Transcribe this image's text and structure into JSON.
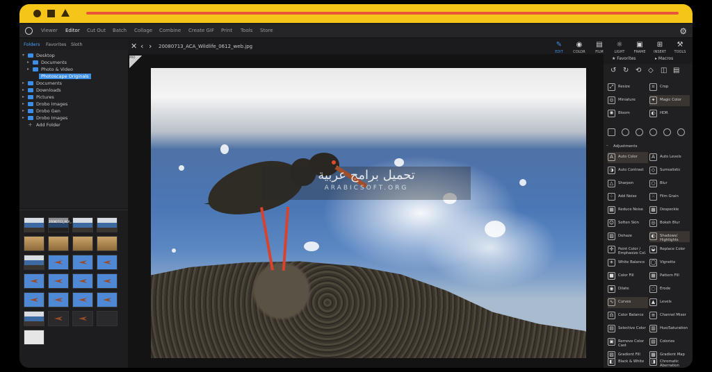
{
  "menu": [
    "Viewer",
    "Editor",
    "Cut Out",
    "Batch",
    "Collage",
    "Combine",
    "Create GIF",
    "Print",
    "Tools",
    "Store"
  ],
  "menu_active": "Editor",
  "side_tabs": [
    "Folders",
    "Favorites",
    "Sloth"
  ],
  "tree": [
    {
      "label": "Desktop",
      "depth": 0,
      "expanded": true
    },
    {
      "label": "Documents",
      "depth": 1
    },
    {
      "label": "Photo & Video",
      "depth": 1
    },
    {
      "label": "Photoscape Originals",
      "depth": 1,
      "selected": true
    },
    {
      "label": "Documents",
      "depth": 0
    },
    {
      "label": "Downloads",
      "depth": 0
    },
    {
      "label": "Pictures",
      "depth": 0
    },
    {
      "label": "Drobo Images",
      "depth": 0
    },
    {
      "label": "Drobo Gen",
      "depth": 0
    },
    {
      "label": "Drobo Images",
      "depth": 0
    },
    {
      "label": "Add Folder",
      "depth": 0,
      "add": true
    }
  ],
  "thumb_caption": "20080713_ACA_..._.jpg",
  "file_name": "20080713_ACA_Wildlife_0612_web.jpg",
  "badge": "PRO",
  "top_tools": [
    "EDIT",
    "COLOR",
    "FILM",
    "LIGHT",
    "FRAME",
    "INSERT",
    "TOOLS"
  ],
  "right_tabs": [
    "Favorites",
    "Macros"
  ],
  "tools_top": [
    [
      "Resize",
      "Crop"
    ],
    [
      "Miniature",
      "Magic Color"
    ],
    [
      "Bloom",
      "HDR"
    ]
  ],
  "adjustments_label": "Adjustments",
  "adjustments": [
    [
      "Auto Color",
      "Auto Levels"
    ],
    [
      "Auto Contrast",
      "Surrealistic"
    ],
    [
      "Sharpen",
      "Blur"
    ],
    [
      "Add Noise",
      "Film Grain"
    ],
    [
      "Reduce Noise",
      "Despeckle"
    ],
    [
      "Soften Skin",
      "Bokeh Blur"
    ],
    [
      "Dehaze",
      "Shadows/ Highlights"
    ],
    [
      "Point Color / Emphasize Col.",
      "Replace Color"
    ],
    [
      "White Balance",
      "Vignette"
    ],
    [
      "Color Fill",
      "Pattern Fill"
    ],
    [
      "Dilate",
      "Erode"
    ],
    [
      "Curves",
      "Levels"
    ],
    [
      "Color Balance",
      "Channel Mixer"
    ],
    [
      "Selective Color",
      "Hue/Saturation"
    ],
    [
      "Remove Color Cast",
      "Colorize"
    ],
    [
      "Gradient Fill",
      "Gradient Map"
    ],
    [
      "Black & White",
      "Chromatic Aberration"
    ]
  ],
  "watermark_ar": "تحميل برامج عربية",
  "watermark_en": "ARABICSOFT.ORG",
  "colors": {
    "titlebar": "#f5c518",
    "accent": "#e8553a",
    "selection": "#3d8ee6"
  }
}
